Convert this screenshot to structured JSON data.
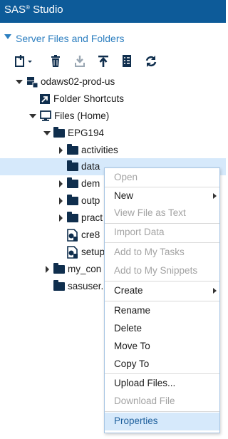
{
  "app": {
    "title_main": "SAS",
    "title_sup": "®",
    "title_rest": " Studio"
  },
  "panel": {
    "title": "Server Files and Folders"
  },
  "toolbar": {
    "buttons": [
      {
        "icon": "new-item-icon"
      },
      {
        "icon": "delete-icon"
      },
      {
        "icon": "download-icon"
      },
      {
        "icon": "upload-icon"
      },
      {
        "icon": "properties-icon"
      },
      {
        "icon": "refresh-icon"
      }
    ]
  },
  "tree": {
    "server": "odaws02-prod-us",
    "folder_shortcuts": "Folder Shortcuts",
    "files_home": "Files (Home)",
    "epg194": "EPG194",
    "activities": "activities",
    "data": "data",
    "demos": "dem",
    "output": "outp",
    "practices": "pract",
    "cre8": "cre8",
    "setup": "setup",
    "my_content": "my_con",
    "sasuser": "sasuser."
  },
  "context_menu": {
    "items": [
      {
        "label": "Open",
        "disabled": true
      },
      {
        "label": "New",
        "submenu": true
      },
      {
        "label": "View File as Text",
        "disabled": true
      },
      {
        "label": "Import Data",
        "disabled": true
      },
      {
        "label": "Add to My Tasks",
        "disabled": true
      },
      {
        "label": "Add to My Snippets",
        "disabled": true
      },
      {
        "label": "Create",
        "submenu": true
      },
      {
        "label": "Rename"
      },
      {
        "label": "Delete"
      },
      {
        "label": "Move To"
      },
      {
        "label": "Copy To"
      },
      {
        "label": "Upload Files..."
      },
      {
        "label": "Download File",
        "disabled": true
      },
      {
        "label": "Properties",
        "highlighted": true
      }
    ]
  },
  "colors": {
    "titlebar": "#0d5b99",
    "accent": "#2d7fc0",
    "selection": "#d6e9fb",
    "folder": "#0f2e4d"
  }
}
